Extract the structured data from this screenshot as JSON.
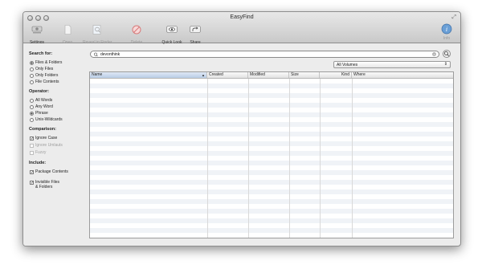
{
  "window": {
    "title": "EasyFind"
  },
  "toolbar": {
    "settings": "Settings",
    "open": "Open",
    "reveal": "Reveal in Finder",
    "delete": "Delete",
    "quicklook": "Quick Look",
    "share": "Share",
    "info": "Info"
  },
  "sidebar": {
    "search_for": {
      "heading": "Search for:",
      "options": [
        "Files & Folders",
        "Only Files",
        "Only Folders",
        "File Contents"
      ],
      "selected": "Files & Folders"
    },
    "operator": {
      "heading": "Operator:",
      "options": [
        "All Words",
        "Any Word",
        "Phrase",
        "Unix-Wildcards"
      ],
      "selected": "Phrase"
    },
    "comparison": {
      "heading": "Comparison:",
      "ignore_case": "Ignore Case",
      "ignore_umlauts": "Ignore Umlauts",
      "fuzzy": "Fuzzy"
    },
    "include": {
      "heading": "Include:",
      "package_contents": "Package Contents",
      "invisible_1": "Invisible Files",
      "invisible_2": "& Folders"
    }
  },
  "search": {
    "value": "devonthink"
  },
  "volume": {
    "selected": "All Volumes"
  },
  "table": {
    "columns": [
      "Name",
      "Created",
      "Modified",
      "Size",
      "Kind",
      "Where"
    ],
    "sorted_column": "Name",
    "rows": []
  },
  "colors": {
    "selection": "#b9cde6",
    "stripe": "#f0f3f7"
  },
  "icons": [
    "settings-icon",
    "open-icon",
    "reveal-icon",
    "delete-icon",
    "quicklook-icon",
    "share-icon",
    "info-icon",
    "search-icon"
  ]
}
